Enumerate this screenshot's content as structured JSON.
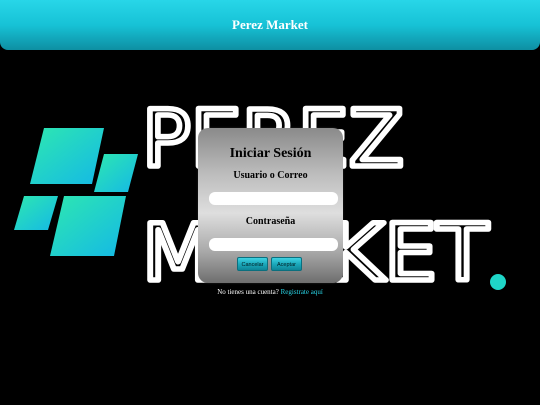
{
  "header": {
    "title": "Perez Market"
  },
  "background_logo": {
    "line1": "PEREZ",
    "line2": "MARKET",
    "dot": ".",
    "accent_color": "#1fd6c8"
  },
  "login": {
    "title": "Iniciar Sesión",
    "username_label": "Usuario o Correo",
    "username_value": "",
    "password_label": "Contraseña",
    "password_value": "",
    "cancel_label": "Cancelar",
    "accept_label": "Aceptar"
  },
  "footer": {
    "prompt": "No tienes una cuenta?",
    "register_link": "Registrate aquí"
  },
  "colors": {
    "header": "#1cc8dc",
    "background": "#000000",
    "link": "#28d6e8"
  }
}
